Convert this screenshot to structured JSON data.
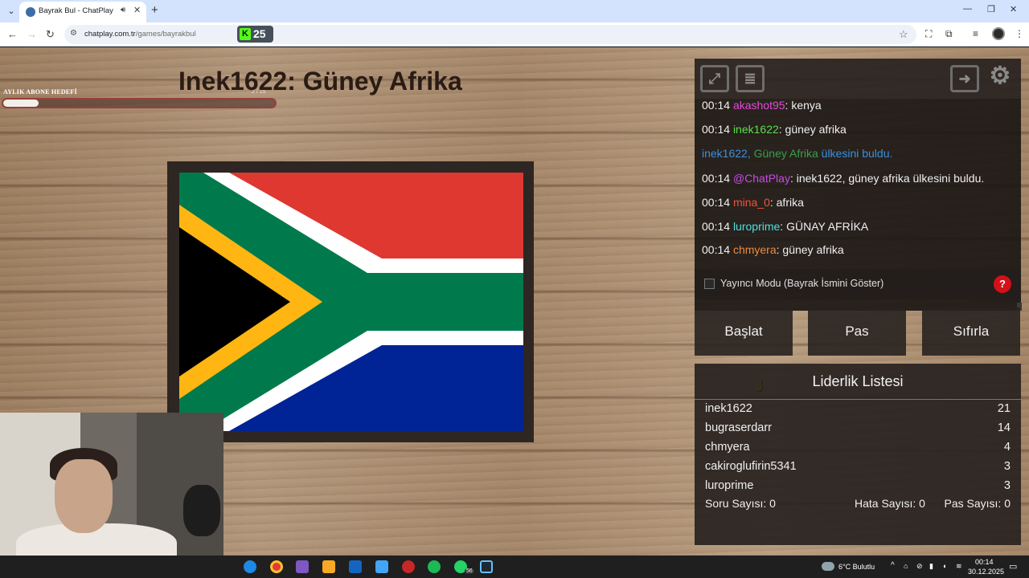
{
  "browser": {
    "tab_title": "Bayrak Bul - ChatPlay",
    "url_host": "chatplay.com.tr",
    "url_path": "/games/bayrakbul",
    "kick_viewers": "25"
  },
  "game": {
    "sub_goal_label": "AYLIK ABONE HEDEFİ",
    "sub_goal_count": "2 / 15",
    "sub_goal_progress": 0.13,
    "title": "Inek1622: Güney Afrika"
  },
  "chat": [
    {
      "time": "00:14",
      "user": "akashot95",
      "user_color": "#e34adb",
      "text": "kenya"
    },
    {
      "time": "00:14",
      "user": "inek1622",
      "user_color": "#58e04a",
      "text": "güney afrika"
    },
    {
      "system": true,
      "user": "inek1622,",
      "country": "Güney Afrika",
      "rest": "ülkesini buldu."
    },
    {
      "time": "00:14",
      "user": "@ChatPlay",
      "user_color": "#c74ae6",
      "text": "inek1622, güney afrika ülkesini buldu."
    },
    {
      "time": "00:14",
      "user": "mina_0",
      "user_color": "#f0543c",
      "text": "afrika"
    },
    {
      "time": "00:14",
      "user": "luroprime",
      "user_color": "#4de0e0",
      "text": "GÜNAY AFRİKA"
    },
    {
      "time": "00:14",
      "user": "chmyera",
      "user_color": "#f08a3c",
      "text": "güney afrika"
    }
  ],
  "streamer_mode_label": "Yayıncı Modu (Bayrak İsmini Göster)",
  "help_label": "?",
  "buttons": {
    "start": "Başlat",
    "pass": "Pas",
    "reset": "Sıfırla"
  },
  "leaderboard": {
    "title": "Liderlik Listesi",
    "rows": [
      {
        "name": "inek1622",
        "score": "21"
      },
      {
        "name": "bugraserdarr",
        "score": "14"
      },
      {
        "name": "chmyera",
        "score": "4"
      },
      {
        "name": "cakiroglufirin5341",
        "score": "3"
      },
      {
        "name": "luroprime",
        "score": "3"
      }
    ],
    "questions": "Soru Sayısı: 0",
    "errors": "Hata Sayısı: 0",
    "passes": "Pas Sayısı: 0"
  },
  "taskbar": {
    "weather": "6°C  Bulutlu",
    "time": "00:14",
    "date": "30.12.2025",
    "whatsapp_badge": "56"
  }
}
